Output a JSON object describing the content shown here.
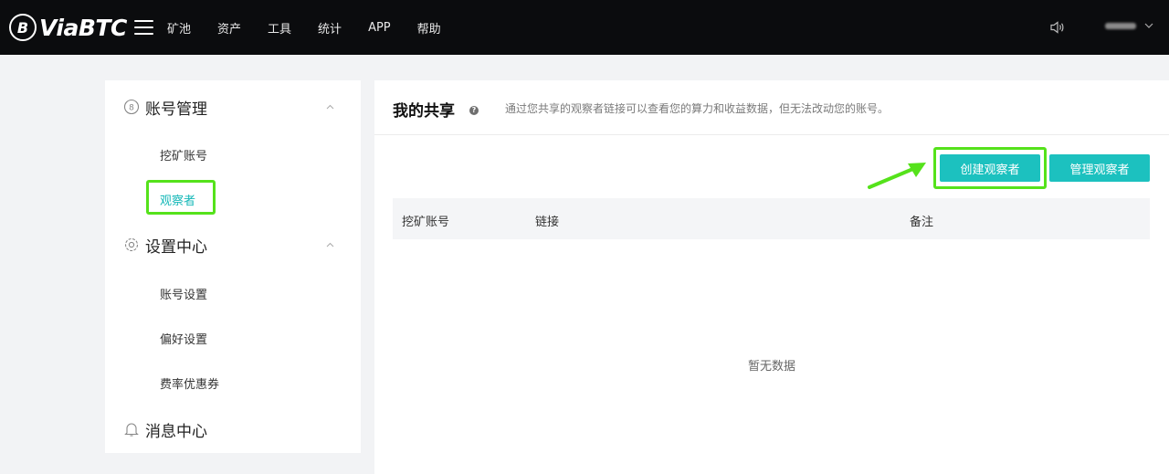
{
  "header": {
    "logo_mark": "B",
    "logo_text": "ViaBTC",
    "nav": [
      "矿池",
      "资产",
      "工具",
      "统计",
      "APP",
      "帮助"
    ]
  },
  "sidebar": {
    "groups": [
      {
        "title": "账号管理",
        "icon": "account-icon",
        "items": [
          "挖矿账号",
          "观察者"
        ]
      },
      {
        "title": "设置中心",
        "icon": "settings-gear-icon",
        "items": [
          "账号设置",
          "偏好设置",
          "费率优惠券"
        ]
      },
      {
        "title": "消息中心",
        "icon": "bell-icon",
        "items": []
      }
    ],
    "active_item": "观察者"
  },
  "main": {
    "title": "我的共享",
    "description": "通过您共享的观察者链接可以查看您的算力和收益数据，但无法改动您的账号。",
    "buttons": {
      "create": "创建观察者",
      "manage": "管理观察者"
    },
    "table": {
      "headers": [
        "挖矿账号",
        "链接",
        "备注"
      ]
    },
    "empty_text": "暂无数据"
  },
  "colors": {
    "accent": "#1cc1bf",
    "highlight": "#55e21b",
    "topbar": "#0b0c0e"
  }
}
